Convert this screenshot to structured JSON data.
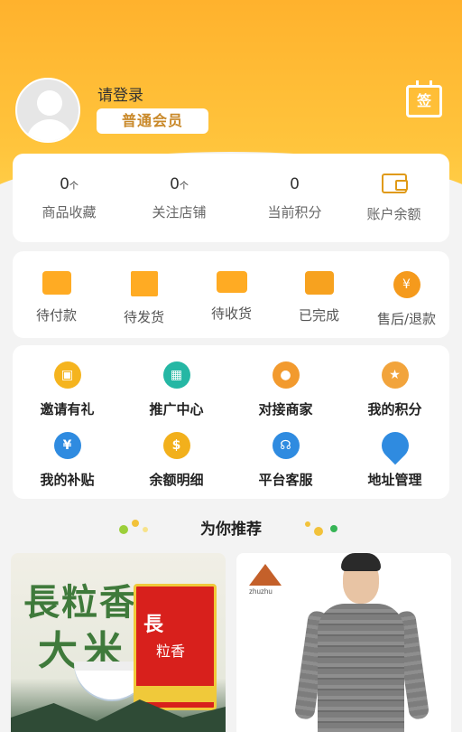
{
  "header": {
    "login_text": "请登录",
    "member_level": "普通会员",
    "sign_in_label": "签"
  },
  "stats": [
    {
      "value": "0",
      "unit": "个",
      "label": "商品收藏"
    },
    {
      "value": "0",
      "unit": "个",
      "label": "关注店铺"
    },
    {
      "value": "0",
      "unit": "",
      "label": "当前积分"
    },
    {
      "label": "账户余额"
    }
  ],
  "orders": [
    {
      "label": "待付款",
      "icon": "wallet-icon"
    },
    {
      "label": "待发货",
      "icon": "package-icon"
    },
    {
      "label": "待收货",
      "icon": "truck-icon"
    },
    {
      "label": "已完成",
      "icon": "chat-icon"
    },
    {
      "label": "售后/退款",
      "icon": "yen-icon"
    }
  ],
  "services": [
    {
      "label": "邀请有礼",
      "icon": "gift-icon",
      "color": "#f5b41e"
    },
    {
      "label": "推广中心",
      "icon": "store-icon",
      "color": "#25b7a4"
    },
    {
      "label": "对接商家",
      "icon": "merchant-icon",
      "color": "#f29a2e"
    },
    {
      "label": "我的积分",
      "icon": "medal-icon",
      "color": "#f2a43c"
    },
    {
      "label": "我的补贴",
      "icon": "yen-coin-icon",
      "color": "#2f8be0"
    },
    {
      "label": "余额明细",
      "icon": "money-bag-icon",
      "color": "#f2b01c"
    },
    {
      "label": "平台客服",
      "icon": "headset-icon",
      "color": "#2f8be0"
    },
    {
      "label": "地址管理",
      "icon": "location-pin-icon",
      "color": "#2f8be0"
    }
  ],
  "recommend": {
    "title": "为你推荐"
  },
  "products": [
    {
      "name": "rice-product",
      "text_line1": "長粒香",
      "text_line2": "大米",
      "bag_line1": "長",
      "bag_line2": "粒香"
    },
    {
      "name": "thermal-underwear-product",
      "brand": "zhuzhu"
    }
  ],
  "colors": {
    "header": "#ffb22d",
    "accent": "#e09a16",
    "background": "#f3f3f3"
  }
}
